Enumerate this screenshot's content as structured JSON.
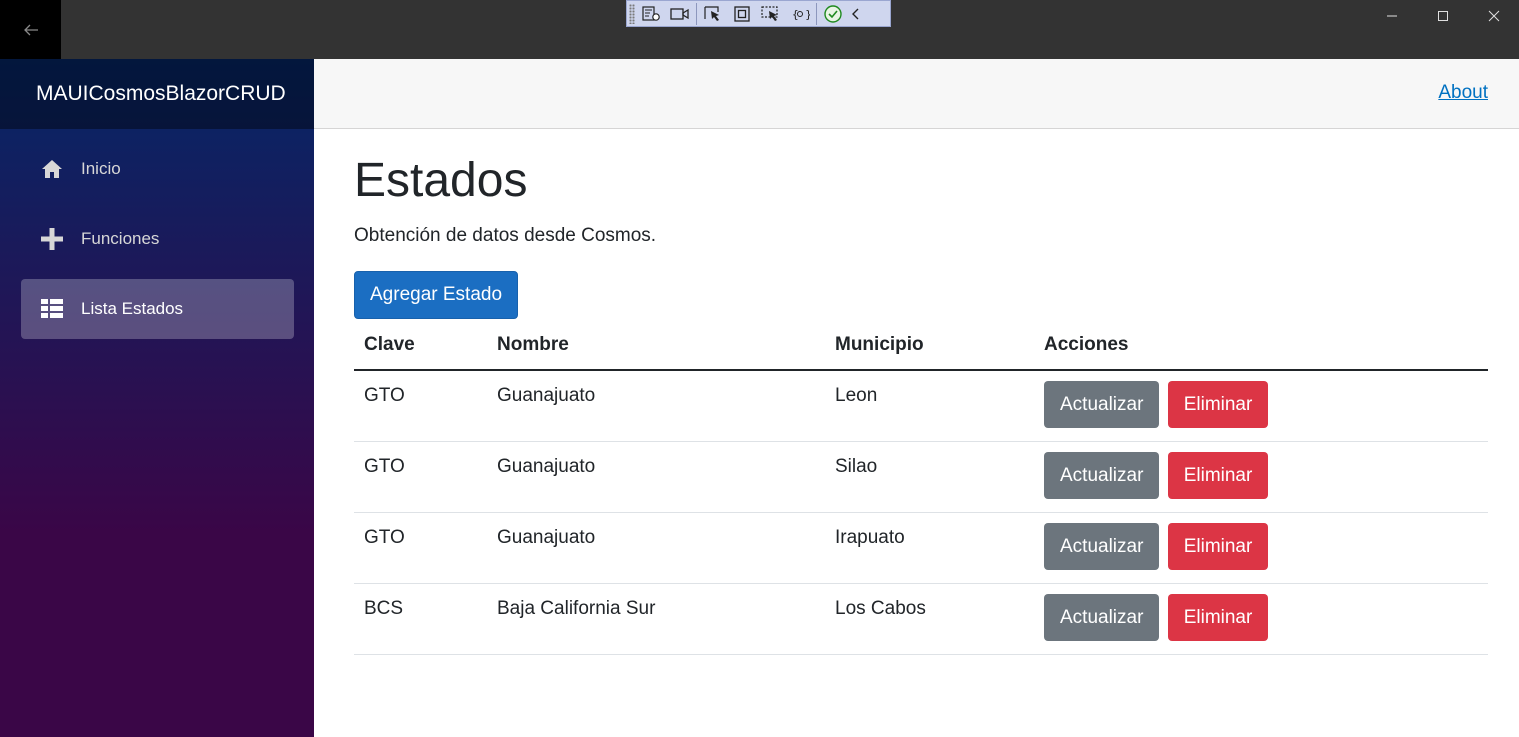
{
  "app": {
    "brand": "MAUICosmosBlazorCRUD",
    "about_link": "About"
  },
  "colors": {
    "primary": "#1b6ec2",
    "secondary": "#6c757d",
    "danger": "#dc3545",
    "sidebar_top": "#052767",
    "sidebar_bottom": "#3a0647",
    "link": "#0071c1"
  },
  "sidebar": {
    "items": [
      {
        "label": "Inicio",
        "icon": "home-icon",
        "active": false
      },
      {
        "label": "Funciones",
        "icon": "plus-icon",
        "active": false
      },
      {
        "label": "Lista Estados",
        "icon": "list-rich-icon",
        "active": true
      }
    ]
  },
  "main": {
    "title": "Estados",
    "subtitle": "Obtención de datos desde Cosmos.",
    "add_button": "Agregar Estado",
    "table": {
      "headers": [
        "Clave",
        "Nombre",
        "Municipio",
        "Acciones"
      ],
      "rows": [
        {
          "clave": "GTO",
          "nombre": "Guanajuato",
          "municipio": "Leon"
        },
        {
          "clave": "GTO",
          "nombre": "Guanajuato",
          "municipio": "Silao"
        },
        {
          "clave": "GTO",
          "nombre": "Guanajuato",
          "municipio": "Irapuato"
        },
        {
          "clave": "BCS",
          "nombre": "Baja California Sur",
          "municipio": "Los Cabos"
        }
      ],
      "update_label": "Actualizar",
      "delete_label": "Eliminar"
    }
  }
}
